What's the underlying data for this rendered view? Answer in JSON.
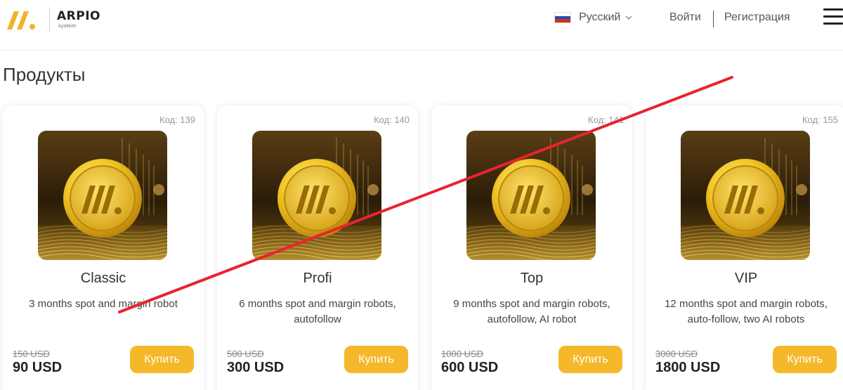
{
  "brand": {
    "name": "ARPIO",
    "tagline": "system",
    "color": "#f0b428"
  },
  "header": {
    "language": {
      "label": "Русский",
      "icon": "russia-flag-icon"
    },
    "login_label": "Войти",
    "register_label": "Регистрация",
    "menu_icon": "hamburger-menu-icon"
  },
  "page": {
    "title": "Продукты"
  },
  "products": [
    {
      "code": "Код: 139",
      "name": "Classic",
      "description": "3 months spot and margin robot",
      "old_price": "150 USD",
      "price": "90 USD",
      "buy_label": "Купить"
    },
    {
      "code": "Код: 140",
      "name": "Profi",
      "description": "6 months spot and margin robots, autofollow",
      "old_price": "500 USD",
      "price": "300 USD",
      "buy_label": "Купить"
    },
    {
      "code": "Код: 141",
      "name": "Top",
      "description": "9 months spot and margin robots, autofollow, AI robot",
      "old_price": "1000 USD",
      "price": "600 USD",
      "buy_label": "Купить"
    },
    {
      "code": "Код: 155",
      "name": "VIP",
      "description": "12 months spot and margin robots, auto-follow, two AI robots",
      "old_price": "3000 USD",
      "price": "1800 USD",
      "buy_label": "Купить"
    }
  ],
  "colors": {
    "accent": "#f5b82a",
    "strike": "#e8242f"
  }
}
